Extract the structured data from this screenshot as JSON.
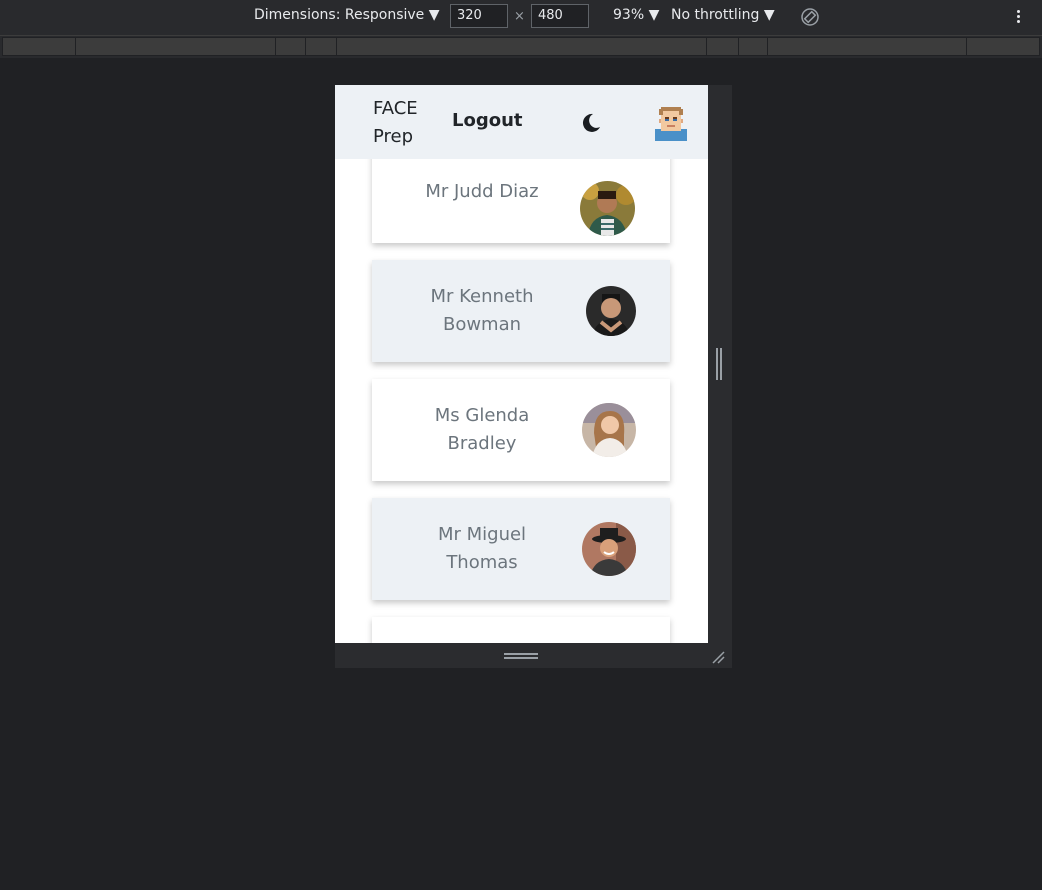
{
  "devtools": {
    "dimensions_label": "Dimensions: Responsive ▼",
    "width_value": "320",
    "times_sign": "×",
    "height_value": "480",
    "zoom_label": "93% ▼",
    "throttling_label": "No throttling ▼",
    "rotate_icon": "rotate-icon",
    "more_icon": "more-vert-icon"
  },
  "app": {
    "brand_line1": "FACE",
    "brand_line2": "Prep",
    "logout_label": "Logout",
    "theme_icon": "moon-icon",
    "user_avatar_icon": "pixel-avatar-icon",
    "colors": {
      "nav_bg": "#edf1f5",
      "card_alt_bg": "#edf1f5",
      "card_bg": "#ffffff",
      "name_text": "#6c757d"
    }
  },
  "users": [
    {
      "name": "Mr Judd Diaz",
      "photo": "profile-photo"
    },
    {
      "name": "Mr Kenneth Bowman",
      "photo": "profile-photo"
    },
    {
      "name": "Ms Glenda Bradley",
      "photo": "profile-photo"
    },
    {
      "name": "Mr Miguel Thomas",
      "photo": "profile-photo"
    }
  ]
}
